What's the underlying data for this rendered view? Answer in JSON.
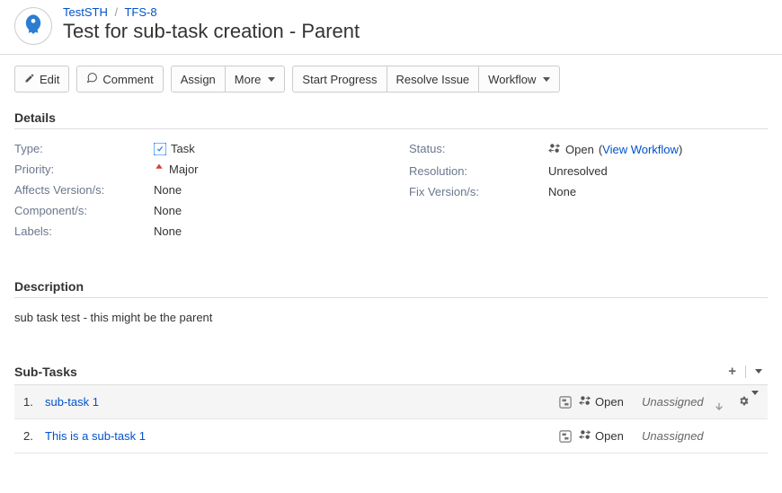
{
  "breadcrumb": {
    "project": "TestSTH",
    "issueKey": "TFS-8"
  },
  "title": "Test for sub-task creation - Parent",
  "toolbar": {
    "edit": "Edit",
    "comment": "Comment",
    "assign": "Assign",
    "more": "More",
    "startProgress": "Start Progress",
    "resolveIssue": "Resolve Issue",
    "workflow": "Workflow"
  },
  "sections": {
    "details": "Details",
    "description": "Description",
    "subTasks": "Sub-Tasks"
  },
  "details": {
    "left": {
      "typeLabel": "Type:",
      "typeValue": "Task",
      "priorityLabel": "Priority:",
      "priorityValue": "Major",
      "affectsVersionsLabel": "Affects Version/s:",
      "affectsVersionsValue": "None",
      "componentsLabel": "Component/s:",
      "componentsValue": "None",
      "labelsLabel": "Labels:",
      "labelsValue": "None"
    },
    "right": {
      "statusLabel": "Status:",
      "statusValue": "Open",
      "statusParenOpen": "(",
      "statusLink": "View Workflow",
      "statusParenClose": ")",
      "resolutionLabel": "Resolution:",
      "resolutionValue": "Unresolved",
      "fixVersionsLabel": "Fix Version/s:",
      "fixVersionsValue": "None"
    }
  },
  "description": "sub task test - this might be the parent",
  "subTasks": [
    {
      "num": "1.",
      "title": "sub-task 1",
      "status": "Open",
      "assignee": "Unassigned",
      "selected": true,
      "showActions": true
    },
    {
      "num": "2.",
      "title": "This is a sub-task 1",
      "status": "Open",
      "assignee": "Unassigned",
      "selected": false,
      "showActions": false
    }
  ]
}
